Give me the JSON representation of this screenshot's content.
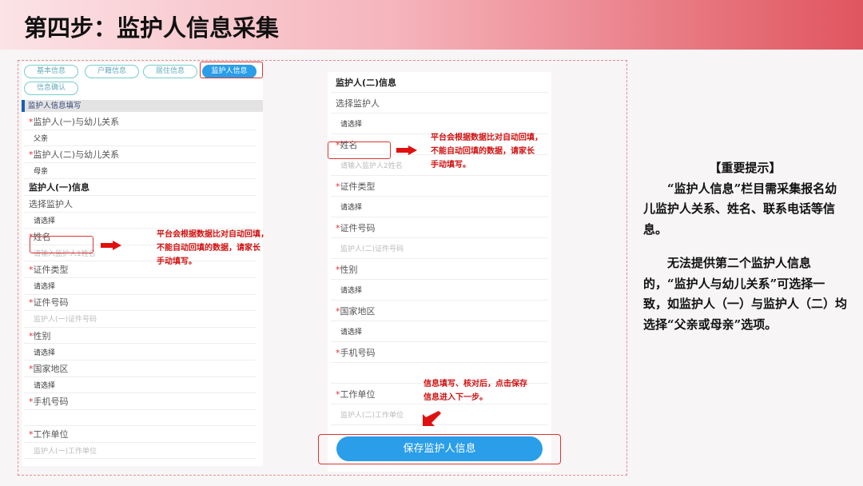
{
  "title": "第四步：监护人信息采集",
  "tabs": [
    "基本信息",
    "户籍信息",
    "居住信息",
    "监护人信息",
    "信息确认"
  ],
  "section_title": "监护人信息填写",
  "left_rows": [
    {
      "t": "lab",
      "s": "*",
      "x": "监护人(一)与幼儿关系"
    },
    {
      "t": "val",
      "x": "父亲"
    },
    {
      "t": "lab",
      "s": "*",
      "x": "监护人(二)与幼儿关系"
    },
    {
      "t": "val",
      "x": "母亲"
    },
    {
      "t": "bold",
      "x": "监护人(一)信息"
    },
    {
      "t": "lab",
      "s": "",
      "x": "选择监护人"
    },
    {
      "t": "val",
      "x": "请选择"
    },
    {
      "t": "lab",
      "s": "*",
      "x": "姓名"
    },
    {
      "t": "ph",
      "x": "请输入监护人1姓名"
    },
    {
      "t": "lab",
      "s": "*",
      "x": "证件类型"
    },
    {
      "t": "val",
      "x": "请选择"
    },
    {
      "t": "lab",
      "s": "*",
      "x": "证件号码"
    },
    {
      "t": "ph",
      "x": "监护人(一)证件号码"
    },
    {
      "t": "lab",
      "s": "*",
      "x": "性别"
    },
    {
      "t": "val",
      "x": "请选择"
    },
    {
      "t": "lab",
      "s": "*",
      "x": "国家地区"
    },
    {
      "t": "val",
      "x": "请选择"
    },
    {
      "t": "lab",
      "s": "*",
      "x": "手机号码"
    },
    {
      "t": "ph",
      "x": ""
    },
    {
      "t": "lab",
      "s": "*",
      "x": "工作单位"
    },
    {
      "t": "ph",
      "x": "监护人(一)工作单位"
    }
  ],
  "right_rows": [
    {
      "t": "bold",
      "x": "监护人(二)信息"
    },
    {
      "t": "lab",
      "s": "",
      "x": "选择监护人"
    },
    {
      "t": "val",
      "x": "请选择"
    },
    {
      "t": "lab",
      "s": "*",
      "x": "姓名"
    },
    {
      "t": "ph",
      "x": "请输入监护人2姓名"
    },
    {
      "t": "lab",
      "s": "*",
      "x": "证件类型"
    },
    {
      "t": "val",
      "x": "请选择"
    },
    {
      "t": "lab",
      "s": "*",
      "x": "证件号码"
    },
    {
      "t": "ph",
      "x": "监护人(二)证件号码"
    },
    {
      "t": "lab",
      "s": "*",
      "x": "性别"
    },
    {
      "t": "val",
      "x": "请选择"
    },
    {
      "t": "lab",
      "s": "*",
      "x": "国家地区"
    },
    {
      "t": "val",
      "x": "请选择"
    },
    {
      "t": "lab",
      "s": "*",
      "x": "手机号码"
    },
    {
      "t": "ph",
      "x": ""
    },
    {
      "t": "lab",
      "s": "*",
      "x": "工作单位"
    },
    {
      "t": "ph",
      "x": "监护人(二)工作单位"
    }
  ],
  "note_autofill": [
    "平台会根据数据比对自动回填，",
    "不能自动回填的数据，请家长",
    "手动填写。"
  ],
  "note_save": [
    "信息填写、核对后，点击保存",
    "信息进入下一步。"
  ],
  "save_button": "保存监护人信息",
  "tips": {
    "heading": "【重要提示】",
    "p1": "“监护人信息”栏目需采集报名幼儿监护人关系、姓名、联系电话等信息。",
    "p2": "无法提供第二个监护人信息的，“监护人与幼儿关系”可选择一致，如监护人（一）与监护人（二）均选择“父亲或母亲”选项。"
  }
}
